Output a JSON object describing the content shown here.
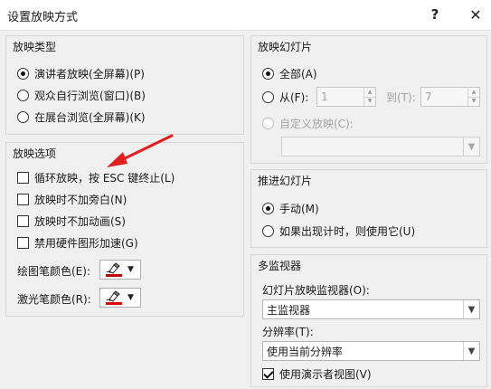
{
  "window": {
    "title": "设置放映方式",
    "help_label": "?",
    "close_label": "✕"
  },
  "show_type": {
    "title": "放映类型",
    "options": [
      {
        "label": "演讲者放映(全屏幕)(P)",
        "checked": true
      },
      {
        "label": "观众自行浏览(窗口)(B)",
        "checked": false
      },
      {
        "label": "在展台浏览(全屏幕)(K)",
        "checked": false
      }
    ]
  },
  "show_options": {
    "title": "放映选项",
    "items": [
      {
        "label": "循环放映，按 ESC 键终止(L)",
        "checked": false
      },
      {
        "label": "放映时不加旁白(N)",
        "checked": false
      },
      {
        "label": "放映时不加动画(S)",
        "checked": false
      },
      {
        "label": "禁用硬件图形加速(G)",
        "checked": false
      }
    ],
    "pen_color_label": "绘图笔颜色(E):",
    "laser_color_label": "激光笔颜色(R):",
    "pen_color": "#c00000",
    "laser_color": "#e00000"
  },
  "slides": {
    "title": "放映幻灯片",
    "all_label": "全部(A)",
    "from_label": "从(F):",
    "from_value": "1",
    "to_label": "到(T):",
    "to_value": "7",
    "custom_label": "自定义放映(C):",
    "custom_value": ""
  },
  "advance": {
    "title": "推进幻灯片",
    "manual_label": "手动(M)",
    "timing_label": "如果出现计时，则使用它(U)"
  },
  "monitors": {
    "title": "多监视器",
    "monitor_label": "幻灯片放映监视器(O):",
    "monitor_value": "主监视器",
    "resolution_label": "分辨率(T):",
    "resolution_value": "使用当前分辨率",
    "presenter_view_label": "使用演示者视图(V)"
  },
  "annotation": {
    "arrow_color": "#e02020"
  }
}
